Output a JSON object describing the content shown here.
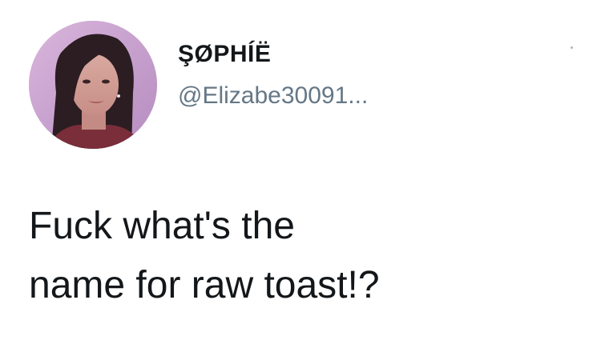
{
  "tweet": {
    "display_name": "ŞØPHÍË",
    "handle": "@Elizabe30091...",
    "text": "Fuck what's the\nname for raw toast!?"
  },
  "icons": {
    "avatar": "profile-photo",
    "menu": "more-options-icon"
  },
  "colors": {
    "name": "#14171a",
    "handle": "#657786",
    "background": "#ffffff",
    "avatar_bg": "#c9a3cf"
  }
}
